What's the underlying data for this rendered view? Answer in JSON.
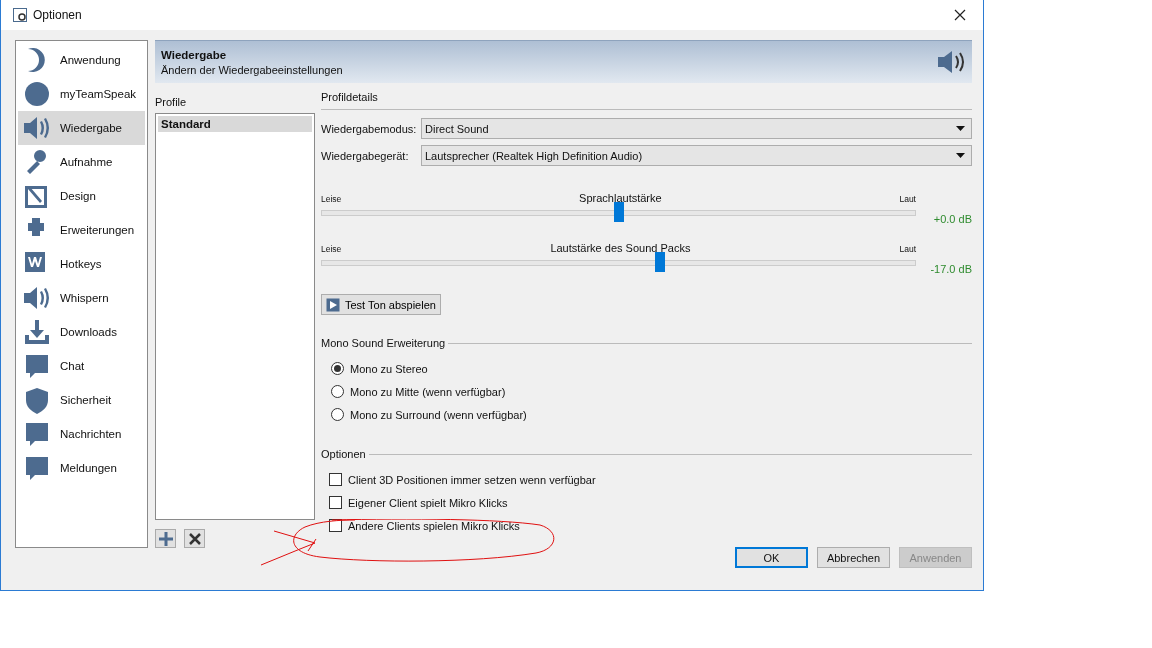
{
  "window": {
    "title": "Optionen"
  },
  "sidebar": {
    "items": [
      {
        "label": "Anwendung",
        "selected": false
      },
      {
        "label": "myTeamSpeak",
        "selected": false
      },
      {
        "label": "Wiedergabe",
        "selected": true
      },
      {
        "label": "Aufnahme",
        "selected": false
      },
      {
        "label": "Design",
        "selected": false
      },
      {
        "label": "Erweiterungen",
        "selected": false
      },
      {
        "label": "Hotkeys",
        "selected": false
      },
      {
        "label": "Whispern",
        "selected": false
      },
      {
        "label": "Downloads",
        "selected": false
      },
      {
        "label": "Chat",
        "selected": false
      },
      {
        "label": "Sicherheit",
        "selected": false
      },
      {
        "label": "Nachrichten",
        "selected": false
      },
      {
        "label": "Meldungen",
        "selected": false
      }
    ]
  },
  "header": {
    "title": "Wiedergabe",
    "subtitle": "Ändern der Wiedergabeeinstellungen"
  },
  "profiles": {
    "label": "Profile",
    "items": [
      {
        "label": "Standard",
        "selected": true
      }
    ]
  },
  "details": {
    "label": "Profildetails",
    "fields": [
      {
        "label": "Wiedergabemodus:",
        "value": "Direct Sound"
      },
      {
        "label": "Wiedergabegerät:",
        "value": "Lautsprecher (Realtek High Definition Audio)"
      }
    ],
    "sliders": [
      {
        "title": "Sprachlautstärke",
        "min_label": "Leise",
        "max_label": "Laut",
        "level": 0.5,
        "reading": "+0.0 dB"
      },
      {
        "title": "Lautstärke des Sound Packs",
        "min_label": "Leise",
        "max_label": "Laut",
        "level": 0.57,
        "reading": "-17.0 dB"
      }
    ],
    "test_button": "Test Ton abspielen",
    "mono": {
      "label": "Mono Sound Erweiterung",
      "options": [
        {
          "label": "Mono zu Stereo",
          "selected": true
        },
        {
          "label": "Mono zu Mitte (wenn verfügbar)",
          "selected": false
        },
        {
          "label": "Mono zu Surround (wenn verfügbar)",
          "selected": false
        }
      ]
    },
    "options": {
      "label": "Optionen",
      "items": [
        {
          "label": "Client 3D Positionen immer setzen wenn verfügbar",
          "checked": false
        },
        {
          "label": "Eigener Client spielt Mikro Klicks",
          "checked": false
        },
        {
          "label": "Andere Clients spielen Mikro Klicks",
          "checked": false
        }
      ]
    }
  },
  "buttons": [
    {
      "label": "OK",
      "default": true,
      "disabled": false
    },
    {
      "label": "Abbrechen",
      "default": false,
      "disabled": false
    },
    {
      "label": "Anwenden",
      "default": false,
      "disabled": true
    }
  ]
}
